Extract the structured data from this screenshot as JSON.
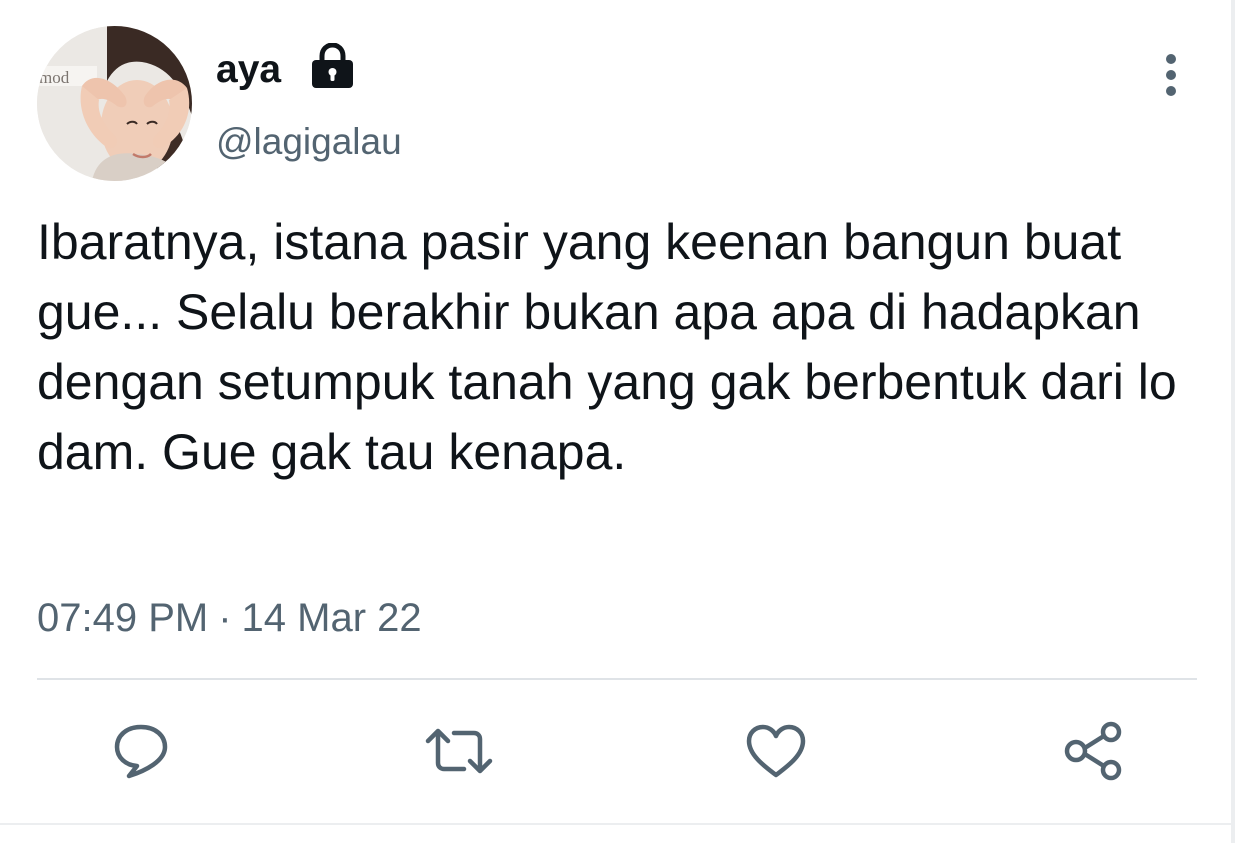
{
  "tweet": {
    "author": {
      "display_name": "aya",
      "handle": "@lagigalau",
      "protected_icon": "lock-icon",
      "avatar_caption": "mod"
    },
    "text": "Ibaratnya, istana pasir yang keenan bangun buat gue... Selalu berakhir bukan apa apa di hadapkan dengan setumpuk tanah yang gak berbentuk dari lo dam. Gue gak tau kenapa.",
    "time": "07:49 PM",
    "separator": "·",
    "date": "14 Mar 22"
  },
  "actions": [
    {
      "name": "reply",
      "icon": "speech-bubble-icon"
    },
    {
      "name": "retweet",
      "icon": "retweet-icon"
    },
    {
      "name": "like",
      "icon": "heart-icon"
    },
    {
      "name": "share",
      "icon": "share-icon"
    }
  ],
  "menu": {
    "icon": "more-vertical-icon"
  },
  "colors": {
    "primary_text": "#0f1419",
    "secondary_text": "#536471",
    "divider": "#dfe3e7"
  }
}
